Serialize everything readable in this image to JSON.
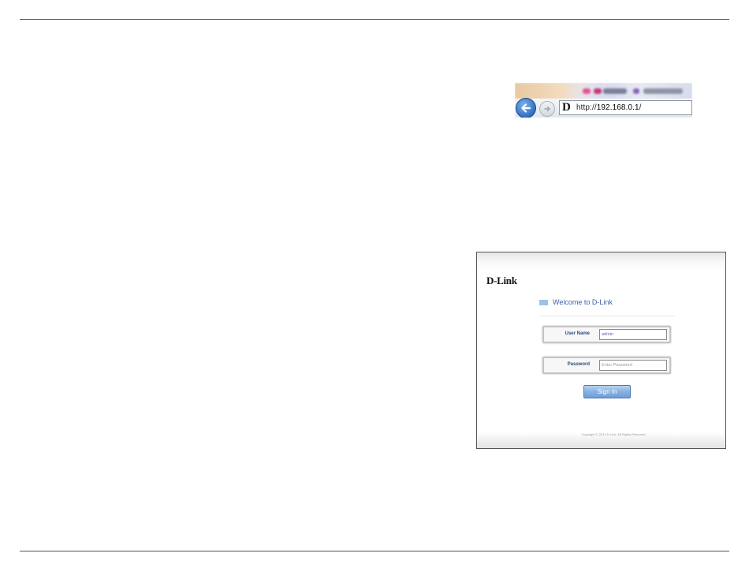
{
  "browser": {
    "url_scheme": "http://",
    "url_host": "192.168.0.1",
    "url_suffix": "/",
    "favicon_letter": "D"
  },
  "login_page": {
    "logo": "D-Link",
    "welcome": "Welcome to D-Link",
    "username_label": "User Name",
    "username_value": "admin",
    "password_label": "Password",
    "password_placeholder": "Enter Password",
    "signin_label": "Sign In",
    "copyright": "Copyright © 2014 D-Link. All Rights Reserved."
  },
  "colors": {
    "accent": "#3c63a5",
    "button": "#86b1e2",
    "back_button": "#2f6fc4"
  },
  "icons": [
    "back-arrow-icon",
    "forward-arrow-icon",
    "dlink-favicon-icon"
  ]
}
